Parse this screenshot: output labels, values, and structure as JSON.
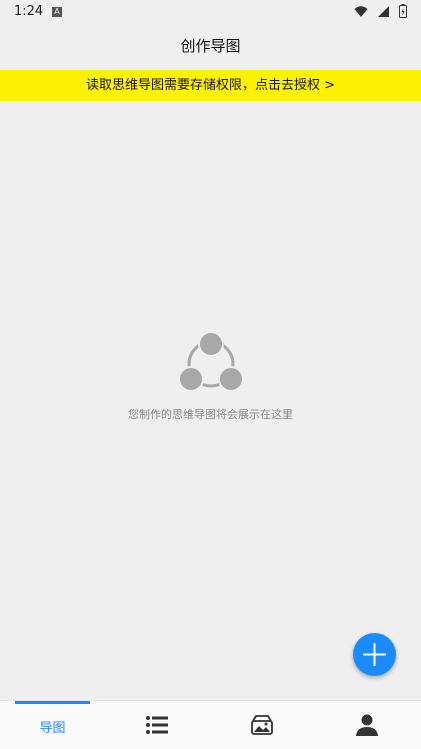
{
  "status_bar": {
    "time": "1:24",
    "notification_icon": "A",
    "icons": [
      "wifi-icon",
      "signal-icon",
      "battery-icon"
    ]
  },
  "header": {
    "title": "创作导图"
  },
  "banner": {
    "text": "读取思维导图需要存储权限，点击去授权 >",
    "background": "#fff200"
  },
  "empty_state": {
    "icon": "mindmap-icon",
    "message": "您制作的思维导图将会展示在这里"
  },
  "fab": {
    "icon": "plus-icon",
    "color": "#1a8cff"
  },
  "bottom_nav": {
    "accent": "#1a8cff",
    "items": [
      {
        "label": "导图",
        "active": true
      },
      {
        "icon": "list-icon"
      },
      {
        "icon": "gallery-icon"
      },
      {
        "icon": "profile-icon"
      }
    ]
  }
}
